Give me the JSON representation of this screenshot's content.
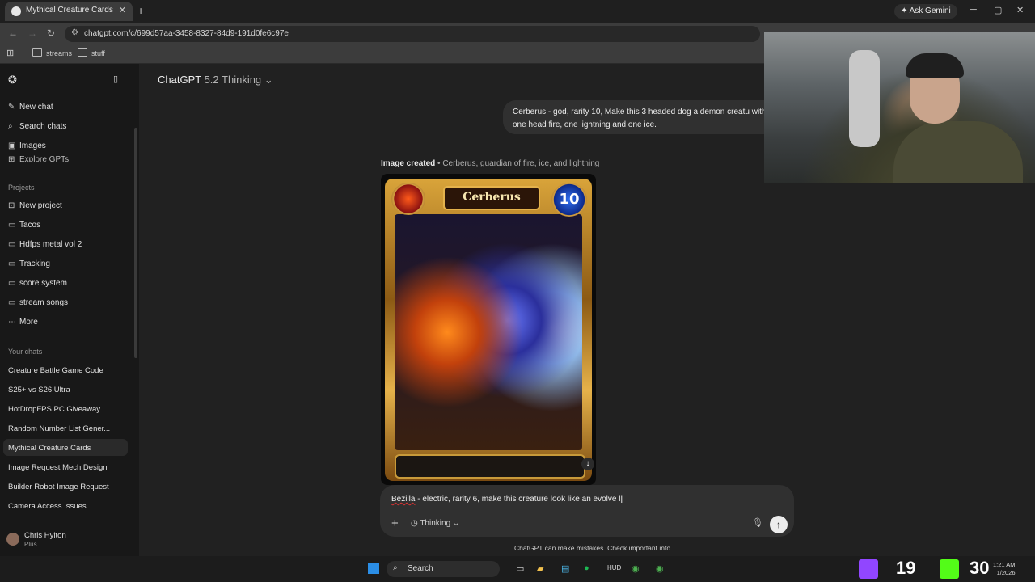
{
  "browser": {
    "tab_title": "Mythical Creature Cards",
    "new_tab": "+",
    "tab_close": "✕",
    "ask_gemini": "Ask Gemini",
    "url": "chatgpt.com/c/699d57aa-3458-8327-84d9-191d0fe6c97e",
    "bookmarks": [
      "streams",
      "stuff"
    ],
    "window_controls": {
      "minimize": "─",
      "maximize": "▢",
      "close": "✕"
    }
  },
  "sidebar": {
    "top_items": [
      {
        "label": "New chat",
        "icon": "pencil-icon"
      },
      {
        "label": "Search chats",
        "icon": "search-icon"
      },
      {
        "label": "Images",
        "icon": "image-icon"
      },
      {
        "label": "Explore GPTs",
        "icon": "grid-icon"
      }
    ],
    "projects_heading": "Projects",
    "projects": [
      "New project",
      "Tacos",
      "Hdfps metal vol 2",
      "Tracking",
      "score system",
      "stream songs",
      "More"
    ],
    "chats_heading": "Your chats",
    "chats": [
      "Creature Battle Game Code",
      "S25+ vs S26 Ultra",
      "HotDropFPS PC Giveaway",
      "Random Number List Gener...",
      "Mythical Creature Cards",
      "Image Request Mech Design",
      "Builder Robot Image Request",
      "Camera Access Issues"
    ],
    "active_chat": "Mythical Creature Cards",
    "user": {
      "name": "Chris Hylton",
      "plan": "Plus"
    }
  },
  "main": {
    "model_name": "ChatGPT",
    "model_version": "5.2 Thinking",
    "user_message": "Cerberus - god, rarity 10, Make this 3 headed dog a demon creatu with one head fire, one lightning and one ice.",
    "image_label": "Image created",
    "image_caption": " • Cerberus, guardian of fire, ice, and lightning",
    "card": {
      "name": "Cerberus",
      "rarity": "10"
    },
    "composer": {
      "text_misspelled": "Bezilla",
      "text_rest": " - electric, rarity 6, make this creature look like an evolve l",
      "mode": "Thinking"
    },
    "disclaimer": "ChatGPT can make mistakes. Check important info."
  },
  "taskbar": {
    "search_label": "Search",
    "stat_1": "19",
    "stat_2": "30",
    "time": "1:21 AM",
    "date": "1/2026"
  },
  "colors": {
    "background": "#212121",
    "sidebar": "#181818",
    "bubble": "#303030",
    "accent_gold": "#e4b24c",
    "rarity_blue": "#2f6ef0"
  }
}
